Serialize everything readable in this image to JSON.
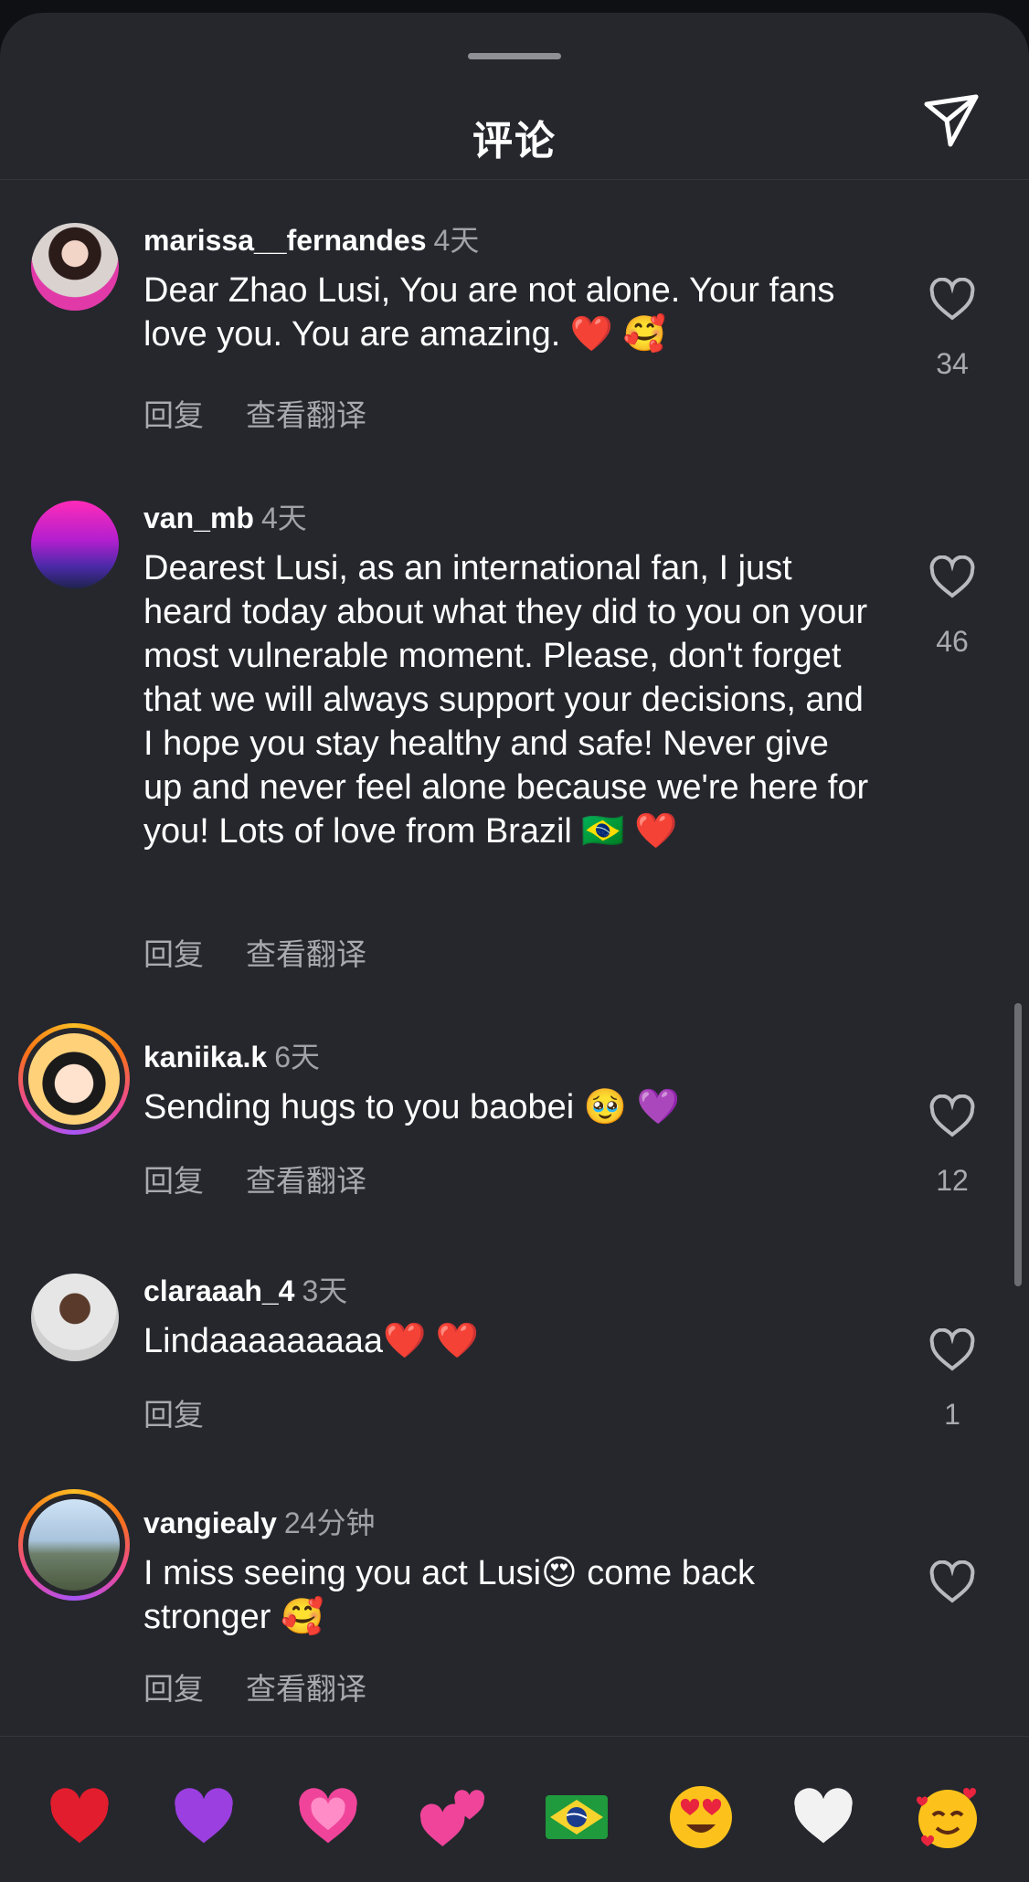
{
  "header": {
    "title": "评论",
    "share_icon": "paper-plane-icon"
  },
  "actions": {
    "reply": "回复",
    "translate": "查看翻译"
  },
  "comments": [
    {
      "username": "marissa__fernandes",
      "time": "4天",
      "text": "Dear Zhao Lusi, You are not alone. Your fans love you. You are amazing.",
      "emojis": "❤️ 🥰",
      "likes": "34",
      "has_translate": true
    },
    {
      "username": "van_mb",
      "time": "4天",
      "text": "Dearest Lusi, as an international fan, I just heard today about what they did to you on your most vulnerable moment. Please, don't forget that we will always support your decisions, and I hope you stay healthy and safe! Never give up and never feel alone because we're here for you! Lots of love from Brazil",
      "emojis": "🇧🇷 ❤️",
      "likes": "46",
      "has_translate": true
    },
    {
      "username": "kaniika.k",
      "time": "6天",
      "text": "Sending hugs to you baobei",
      "emojis": "🥹 💜",
      "likes": "12",
      "has_translate": true
    },
    {
      "username": "claraaah_4",
      "time": "3天",
      "text": "Lindaaaaaaaaa",
      "emojis": "❤️ ❤️",
      "likes": "1",
      "has_translate": false
    },
    {
      "username": "vangiealy",
      "time": "24分钟",
      "text": "I miss seeing you act Lusi",
      "emojis": "😍 come back stronger 🥰",
      "likes": "",
      "has_translate": true
    }
  ],
  "quick_emojis": [
    "❤️",
    "💜",
    "💗",
    "💕",
    "🇧🇷",
    "😍",
    "🤍",
    "🥰"
  ]
}
